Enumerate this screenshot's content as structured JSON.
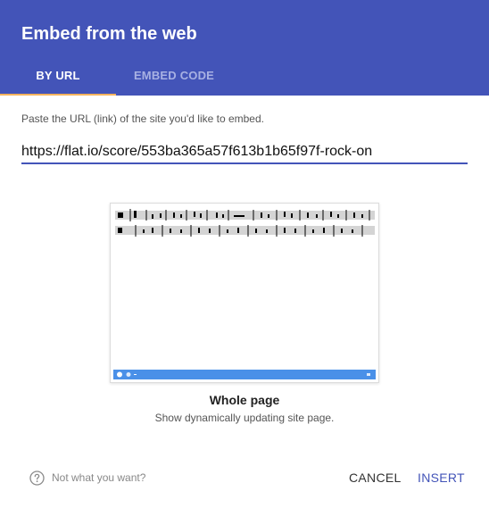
{
  "dialog": {
    "title": "Embed from the web"
  },
  "tabs": [
    {
      "label": "BY URL",
      "selected": true
    },
    {
      "label": "EMBED CODE",
      "selected": false
    }
  ],
  "url_section": {
    "instructions": "Paste the URL (link) of the site you'd like to embed.",
    "url_value": "https://flat.io/score/553ba365a57f613b1b65f97f-rock-on"
  },
  "preview": {
    "option_title": "Whole page",
    "option_description": "Show dynamically updating site page."
  },
  "footer": {
    "help_label": "Not what you want?",
    "cancel_label": "CANCEL",
    "insert_label": "INSERT"
  },
  "colors": {
    "header": "#4354b8",
    "tab_indicator": "#f4b35e",
    "insert_text": "#4354b8",
    "preview_taskbar": "#4a90e8"
  },
  "icons": {
    "help": "question-circle-icon"
  }
}
